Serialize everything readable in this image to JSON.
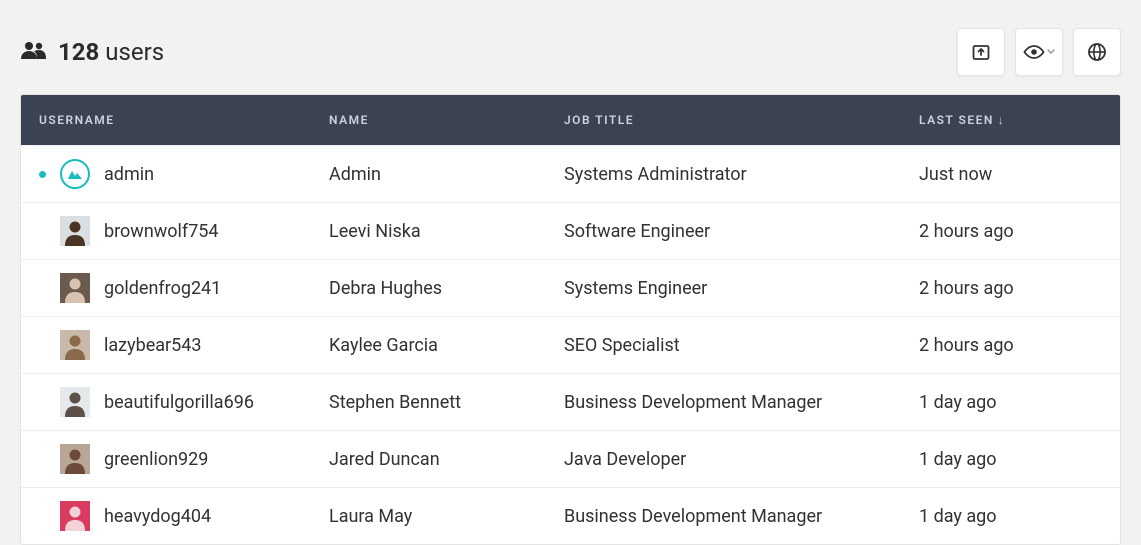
{
  "header": {
    "count": "128",
    "label": "users"
  },
  "columns": {
    "username": "USERNAME",
    "name": "NAME",
    "job": "JOB TITLE",
    "seen": "LAST SEEN",
    "sort_indicator": "↓"
  },
  "rows": [
    {
      "online": true,
      "avatar": "admin",
      "username": "admin",
      "name": "Admin",
      "job": "Systems Administrator",
      "seen": "Just now"
    },
    {
      "online": false,
      "avatar": "a1",
      "username": "brownwolf754",
      "name": "Leevi Niska",
      "job": "Software Engineer",
      "seen": "2 hours ago"
    },
    {
      "online": false,
      "avatar": "a2",
      "username": "goldenfrog241",
      "name": "Debra Hughes",
      "job": "Systems Engineer",
      "seen": "2 hours ago"
    },
    {
      "online": false,
      "avatar": "a3",
      "username": "lazybear543",
      "name": "Kaylee Garcia",
      "job": "SEO Specialist",
      "seen": "2 hours ago"
    },
    {
      "online": false,
      "avatar": "a4",
      "username": "beautifulgorilla696",
      "name": "Stephen Bennett",
      "job": "Business Development Manager",
      "seen": "1 day ago"
    },
    {
      "online": false,
      "avatar": "a5",
      "username": "greenlion929",
      "name": "Jared Duncan",
      "job": "Java Developer",
      "seen": "1 day ago"
    },
    {
      "online": false,
      "avatar": "a6",
      "username": "heavydog404",
      "name": "Laura May",
      "job": "Business Development Manager",
      "seen": "1 day ago"
    }
  ],
  "avatar_colors": {
    "a1": {
      "bg": "#d9dfe3",
      "fg": "#4a3524"
    },
    "a2": {
      "bg": "#6b5a4e",
      "fg": "#d9c2b0"
    },
    "a3": {
      "bg": "#c9b9a8",
      "fg": "#8a6a4a"
    },
    "a4": {
      "bg": "#e6e9ec",
      "fg": "#5c5048"
    },
    "a5": {
      "bg": "#b9a696",
      "fg": "#6b4a3a"
    },
    "a6": {
      "bg": "#d93b5e",
      "fg": "#f2d1d9"
    }
  }
}
